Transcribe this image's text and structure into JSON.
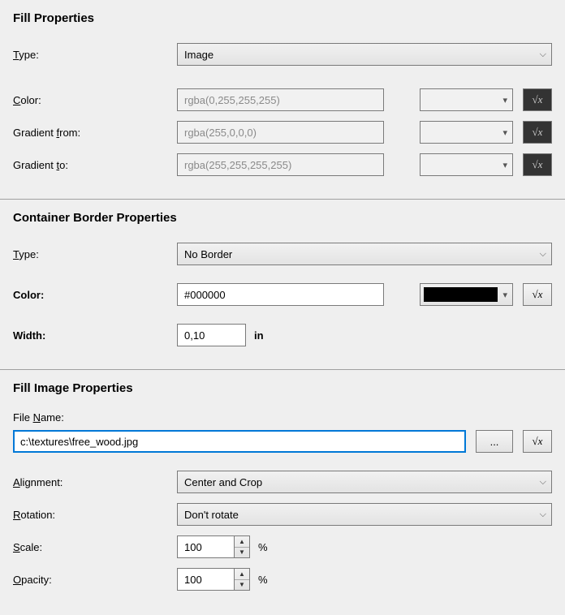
{
  "fill": {
    "title": "Fill Properties",
    "type_label": "Type:",
    "type_value": "Image",
    "color_label": "Color:",
    "color_value": "rgba(0,255,255,255)",
    "grad_from_label": "Gradient from:",
    "grad_from_value": "rgba(255,0,0,0)",
    "grad_to_label": "Gradient to:",
    "grad_to_value": "rgba(255,255,255,255)"
  },
  "border": {
    "title": "Container Border Properties",
    "type_label": "Type:",
    "type_value": "No Border",
    "color_label": "Color:",
    "color_value": "#000000",
    "width_label": "Width:",
    "width_value": "0,10",
    "width_unit": "in"
  },
  "image": {
    "title": "Fill Image Properties",
    "filename_label": "File Name:",
    "filename_value": "c:\\textures\\free_wood.jpg",
    "browse_label": "...",
    "align_label": "Alignment:",
    "align_value": "Center and Crop",
    "rot_label": "Rotation:",
    "rot_value": "Don't rotate",
    "scale_label": "Scale:",
    "scale_value": "100",
    "scale_unit": "%",
    "opacity_label": "Opacity:",
    "opacity_value": "100",
    "opacity_unit": "%"
  },
  "glyph": {
    "fx": "√x"
  }
}
